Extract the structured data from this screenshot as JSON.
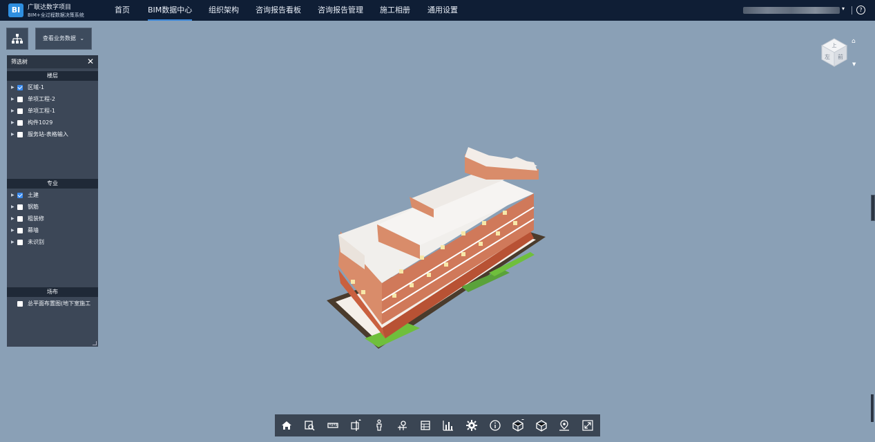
{
  "header": {
    "logo_text": "BI",
    "brand_title": "广联达数字项目",
    "brand_subtitle": "BIM+全过程数据决策系统",
    "nav": [
      {
        "label": "首页",
        "active": false
      },
      {
        "label": "BIM数据中心",
        "active": true
      },
      {
        "label": "组织架构",
        "active": false
      },
      {
        "label": "咨询报告看板",
        "active": false
      },
      {
        "label": "咨询报告管理",
        "active": false
      },
      {
        "label": "施工相册",
        "active": false
      },
      {
        "label": "通用设置",
        "active": false
      }
    ],
    "dropdown_caret": "▾",
    "help": "?",
    "accent": "#3a86d8"
  },
  "controls": {
    "view_data_label": "查看业务数据"
  },
  "filter_tree": {
    "title": "筛选树",
    "close": "✕",
    "sections": [
      {
        "title": "楼层",
        "items": [
          {
            "label": "区域-1",
            "checked": true
          },
          {
            "label": "单项工程-2",
            "checked": false
          },
          {
            "label": "单项工程-1",
            "checked": false
          },
          {
            "label": "构件1029",
            "checked": false
          },
          {
            "label": "服务站-表格输入",
            "checked": false
          }
        ]
      },
      {
        "title": "专业",
        "items": [
          {
            "label": "土建",
            "checked": true
          },
          {
            "label": "钢筋",
            "checked": false
          },
          {
            "label": "粗装修",
            "checked": false
          },
          {
            "label": "幕墙",
            "checked": false
          },
          {
            "label": "未识别",
            "checked": false
          }
        ]
      },
      {
        "title": "场布",
        "items": [
          {
            "label": "总平面布置图(地下室施工",
            "checked": false
          }
        ]
      }
    ]
  },
  "viewcube": {
    "face_top": "上",
    "face_left": "左",
    "face_front": "前"
  },
  "toolbar": [
    {
      "icon": "home-icon"
    },
    {
      "icon": "zoom-area-icon"
    },
    {
      "icon": "measure-icon"
    },
    {
      "icon": "section-icon"
    },
    {
      "icon": "walk-person-icon"
    },
    {
      "icon": "axis-pin-icon"
    },
    {
      "icon": "table-icon"
    },
    {
      "icon": "chart-icon"
    },
    {
      "icon": "settings-icon"
    },
    {
      "icon": "info-icon"
    },
    {
      "icon": "model-tree-icon"
    },
    {
      "icon": "cube-icon"
    },
    {
      "icon": "location-icon"
    },
    {
      "icon": "fullscreen-icon"
    }
  ]
}
